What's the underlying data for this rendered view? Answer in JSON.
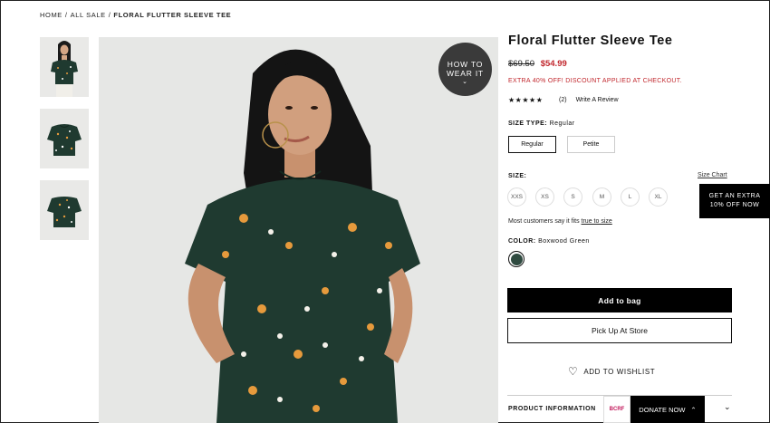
{
  "breadcrumb": {
    "home": "HOME",
    "sep1": "/",
    "all_sale": "ALL SALE",
    "sep2": "/",
    "current": "FLORAL FLUTTER SLEEVE TEE"
  },
  "product": {
    "title": "Floral Flutter Sleeve Tee",
    "original_price": "$69.50",
    "sale_price": "$54.99",
    "promo": "EXTRA 40% OFF! DISCOUNT APPLIED AT CHECKOUT.",
    "stars": "★★★★★",
    "rating_value": 4.5,
    "review_count": "(2)",
    "write_review": "Write A Review"
  },
  "how_to_wear": {
    "line1": "HOW TO",
    "line2": "WEAR IT",
    "chevron": "⌄"
  },
  "size_type": {
    "label": "SIZE TYPE:",
    "value": "Regular",
    "options": [
      "Regular",
      "Petite"
    ]
  },
  "size": {
    "label": "SIZE:",
    "chart_link": "Size Chart",
    "options": [
      "XXS",
      "XS",
      "S",
      "M",
      "L",
      "XL"
    ],
    "fit_text": "Most customers say it fits",
    "fit_link": "true to size"
  },
  "color": {
    "label": "COLOR:",
    "value": "Boxwood Green",
    "swatch_hex": "#2f4a40"
  },
  "actions": {
    "add_to_bag": "Add to bag",
    "pickup": "Pick Up At Store",
    "wishlist": "ADD TO WISHLIST",
    "wishlist_icon": "♡"
  },
  "product_info": {
    "label": "PRODUCT INFORMATION",
    "chevron": "⌄"
  },
  "extra_offer": {
    "line1": "GET AN EXTRA",
    "line2": "10% OFF NOW"
  },
  "donate": {
    "logo": "BCRF",
    "label": "DONATE NOW",
    "chevron": "⌃"
  },
  "colors": {
    "sale_red": "#c1272d",
    "shirt_green": "#1f3a30",
    "accent_orange": "#e69a3c"
  }
}
